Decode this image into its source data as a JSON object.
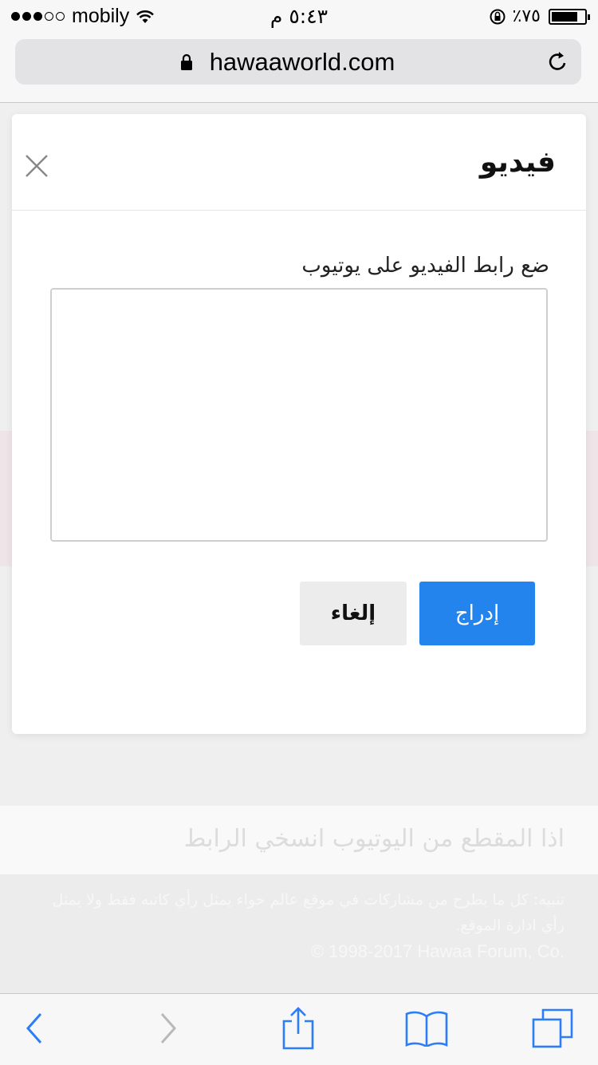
{
  "status_bar": {
    "carrier": "mobily",
    "time": "٥:٤٣ م",
    "battery": "٪٧٥"
  },
  "browser": {
    "url": "hawaaworld.com"
  },
  "background_page": {
    "hint_text": "اذا المقطع من اليوتيوب انسخي الرابط",
    "footer_note": "تنبيه: كل ما يطرح من مشاركات في موقع عالم حواء يمثل رأي كاتبه فقط ولا يمثل رأي ادارة الموقع.",
    "copyright": "© 1998-2017 Hawaa Forum, Co."
  },
  "modal": {
    "title": "فيديو",
    "field_label": "ضع رابط الفيديو على يوتيوب",
    "input_value": "",
    "insert_label": "إدراج",
    "cancel_label": "إلغاء"
  },
  "colors": {
    "primary": "#2384ed",
    "cancel_bg": "#ececec",
    "ios_blue": "#2c7ef8"
  },
  "toolbar": {
    "icons": [
      "back-icon",
      "forward-icon",
      "share-icon",
      "bookmarks-icon",
      "tabs-icon"
    ]
  }
}
